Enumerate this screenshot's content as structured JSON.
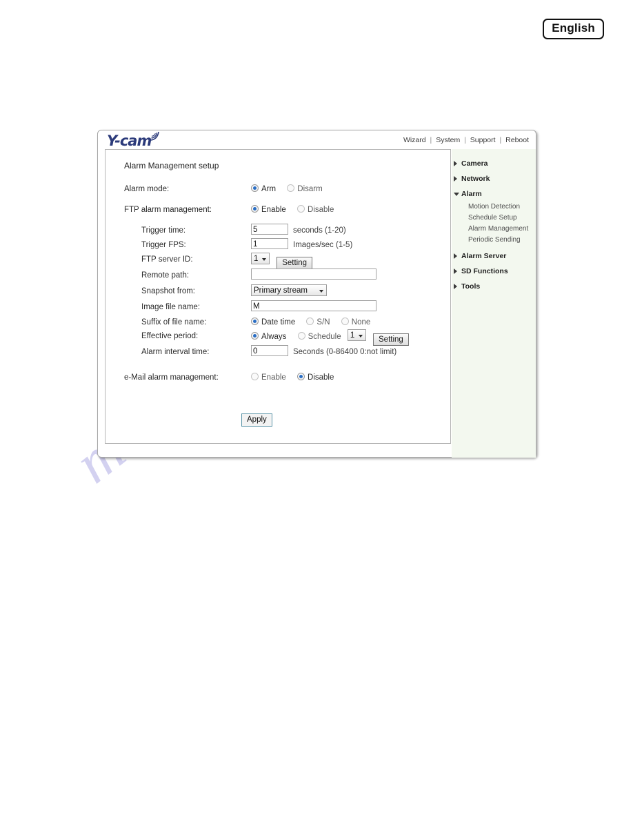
{
  "language_badge": "English",
  "watermark": "manualshive.com",
  "brand": {
    "logo_text": "Y-cam",
    "wifi_icon": "wifi-arc-icon"
  },
  "header": {
    "links": [
      {
        "label": "Wizard"
      },
      {
        "label": "System"
      },
      {
        "label": "Support"
      },
      {
        "label": "Reboot"
      }
    ],
    "separator": "|"
  },
  "sidebar": {
    "groups": [
      {
        "label": "Camera",
        "state": "collapsed",
        "icon": "triangle-right-icon",
        "children": []
      },
      {
        "label": "Network",
        "state": "collapsed",
        "icon": "triangle-right-icon",
        "children": []
      },
      {
        "label": "Alarm",
        "state": "expanded",
        "icon": "triangle-down-icon",
        "children": [
          {
            "label": "Motion Detection"
          },
          {
            "label": "Schedule Setup"
          },
          {
            "label": "Alarm Management"
          },
          {
            "label": "Periodic Sending"
          }
        ]
      },
      {
        "label": "Alarm Server",
        "state": "collapsed",
        "icon": "triangle-right-icon",
        "children": []
      },
      {
        "label": "SD Functions",
        "state": "collapsed",
        "icon": "triangle-right-icon",
        "children": []
      },
      {
        "label": "Tools",
        "state": "collapsed",
        "icon": "triangle-right-icon",
        "children": []
      }
    ]
  },
  "form": {
    "title": "Alarm Management setup",
    "alarm_mode": {
      "label": "Alarm mode:",
      "options": [
        {
          "label": "Arm",
          "selected": true
        },
        {
          "label": "Disarm",
          "selected": false
        }
      ]
    },
    "ftp_alarm_management": {
      "label": "FTP alarm management:",
      "options": [
        {
          "label": "Enable",
          "selected": true
        },
        {
          "label": "Disable",
          "selected": false
        }
      ]
    },
    "trigger_time": {
      "label": "Trigger time:",
      "value": "5",
      "hint": "seconds (1-20)"
    },
    "trigger_fps": {
      "label": "Trigger FPS:",
      "value": "1",
      "hint": "Images/sec (1-5)"
    },
    "ftp_server_id": {
      "label": "FTP server ID:",
      "value": "1",
      "options": [
        "1"
      ],
      "button": "Setting"
    },
    "remote_path": {
      "label": "Remote path:",
      "value": "",
      "placeholder": ""
    },
    "snapshot_from": {
      "label": "Snapshot from:",
      "value": "Primary stream",
      "options": [
        "Primary stream"
      ]
    },
    "image_file_name": {
      "label": "Image file name:",
      "value": "M",
      "placeholder": ""
    },
    "suffix_of_file_name": {
      "label": "Suffix of file name:",
      "options": [
        {
          "label": "Date time",
          "selected": true
        },
        {
          "label": "S/N",
          "selected": false
        },
        {
          "label": "None",
          "selected": false
        }
      ]
    },
    "effective_period": {
      "label": "Effective period:",
      "options": [
        {
          "label": "Always",
          "selected": true
        },
        {
          "label": "Schedule",
          "selected": false
        }
      ],
      "schedule_value": "1",
      "schedule_options": [
        "1"
      ],
      "button": "Setting"
    },
    "alarm_interval_time": {
      "label": "Alarm interval time:",
      "value": "0",
      "hint": "Seconds (0-86400 0:not limit)"
    },
    "email_alarm_management": {
      "label": "e-Mail alarm management:",
      "options": [
        {
          "label": "Enable",
          "selected": false
        },
        {
          "label": "Disable",
          "selected": true
        }
      ]
    },
    "apply_button": "Apply"
  },
  "colors": {
    "logo": "#2b3a7a",
    "radio_dot": "#2a6ec4",
    "sidebar_bg": "#f3f8ef",
    "apply_border": "#5b94a8",
    "watermark": "#b9b6e8"
  }
}
